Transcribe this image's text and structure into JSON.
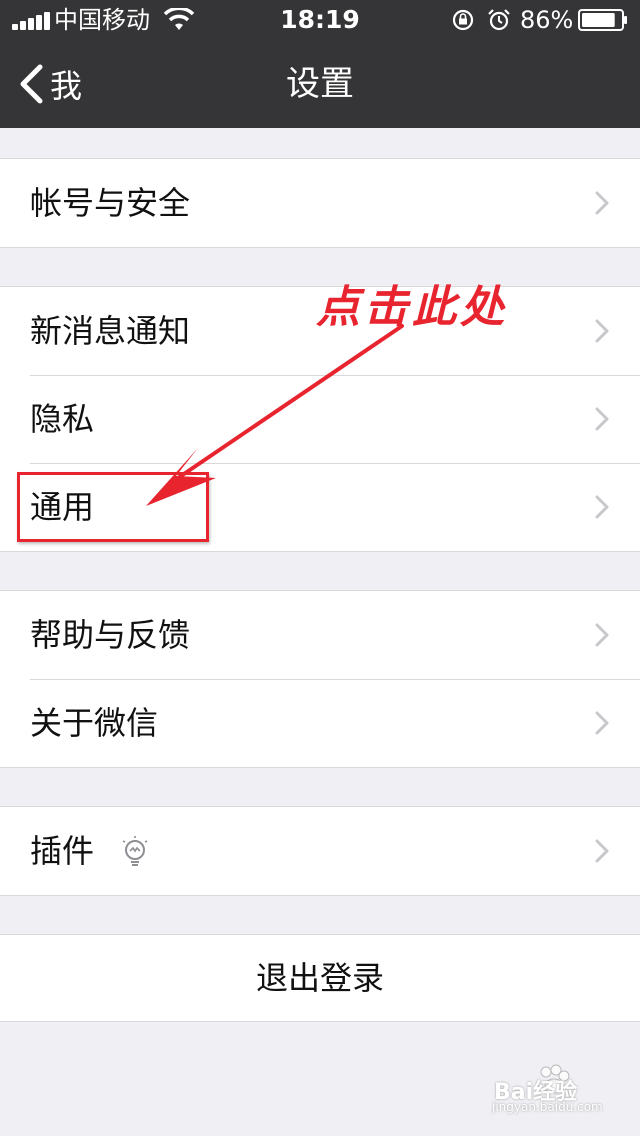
{
  "status_bar": {
    "carrier": "中国移动",
    "time": "18:19",
    "battery_percent": "86%",
    "battery_level": 0.86,
    "icons": [
      "signal-icon",
      "wifi-icon",
      "rotation-lock-icon",
      "alarm-icon",
      "battery-icon"
    ]
  },
  "nav": {
    "back_label": "我",
    "title": "设置"
  },
  "groups": [
    {
      "items": [
        {
          "label": "帐号与安全"
        }
      ]
    },
    {
      "items": [
        {
          "label": "新消息通知"
        },
        {
          "label": "隐私"
        },
        {
          "label": "通用"
        }
      ]
    },
    {
      "items": [
        {
          "label": "帮助与反馈"
        },
        {
          "label": "关于微信"
        }
      ]
    },
    {
      "items": [
        {
          "label": "插件",
          "icon": "lightbulb-icon"
        }
      ]
    }
  ],
  "logout_label": "退出登录",
  "annotation": {
    "text": "点击此处",
    "color": "#e8242f"
  },
  "watermark": {
    "brand": "Bai经验",
    "url": "jingyan.baidu.com"
  },
  "colors": {
    "nav_background": "#353537",
    "page_background": "#efeff4",
    "separator": "#d9d9d9",
    "chevron": "#c7c7cc"
  }
}
